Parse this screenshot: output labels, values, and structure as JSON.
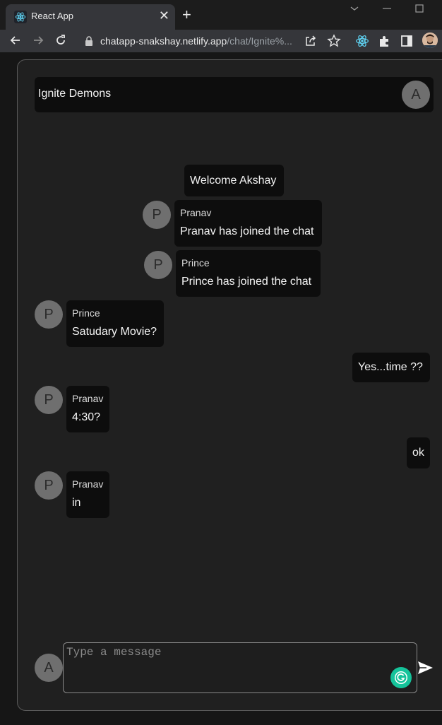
{
  "browser": {
    "tab_title": "React App",
    "tab_close": "✕",
    "new_tab": "+",
    "url_domain": "chatapp-snakshay.netlify.app",
    "url_path": "/chat/Ignite%..."
  },
  "header": {
    "room_name": "Ignite Demons",
    "user_initial": "A"
  },
  "welcome": "Welcome Akshay",
  "messages": [
    {
      "initial": "P",
      "sender": "Pranav",
      "text": "Pranav has joined the chat"
    },
    {
      "initial": "P",
      "sender": "Prince",
      "text": "Prince has joined the chat"
    },
    {
      "initial": "P",
      "sender": "Prince",
      "text": "Satudary Movie?"
    },
    {
      "text": "Yes...time ??"
    },
    {
      "initial": "P",
      "sender": "Pranav",
      "text": "4:30?"
    },
    {
      "text": "ok"
    },
    {
      "initial": "P",
      "sender": "Pranav",
      "text": "in"
    }
  ],
  "composer": {
    "user_initial": "A",
    "placeholder": "Type a message",
    "value": ""
  },
  "colors": {
    "background": "#202020",
    "bubble": "#0d0d0d",
    "avatar": "#6f6f6f",
    "grammarly": "#15c39a"
  }
}
